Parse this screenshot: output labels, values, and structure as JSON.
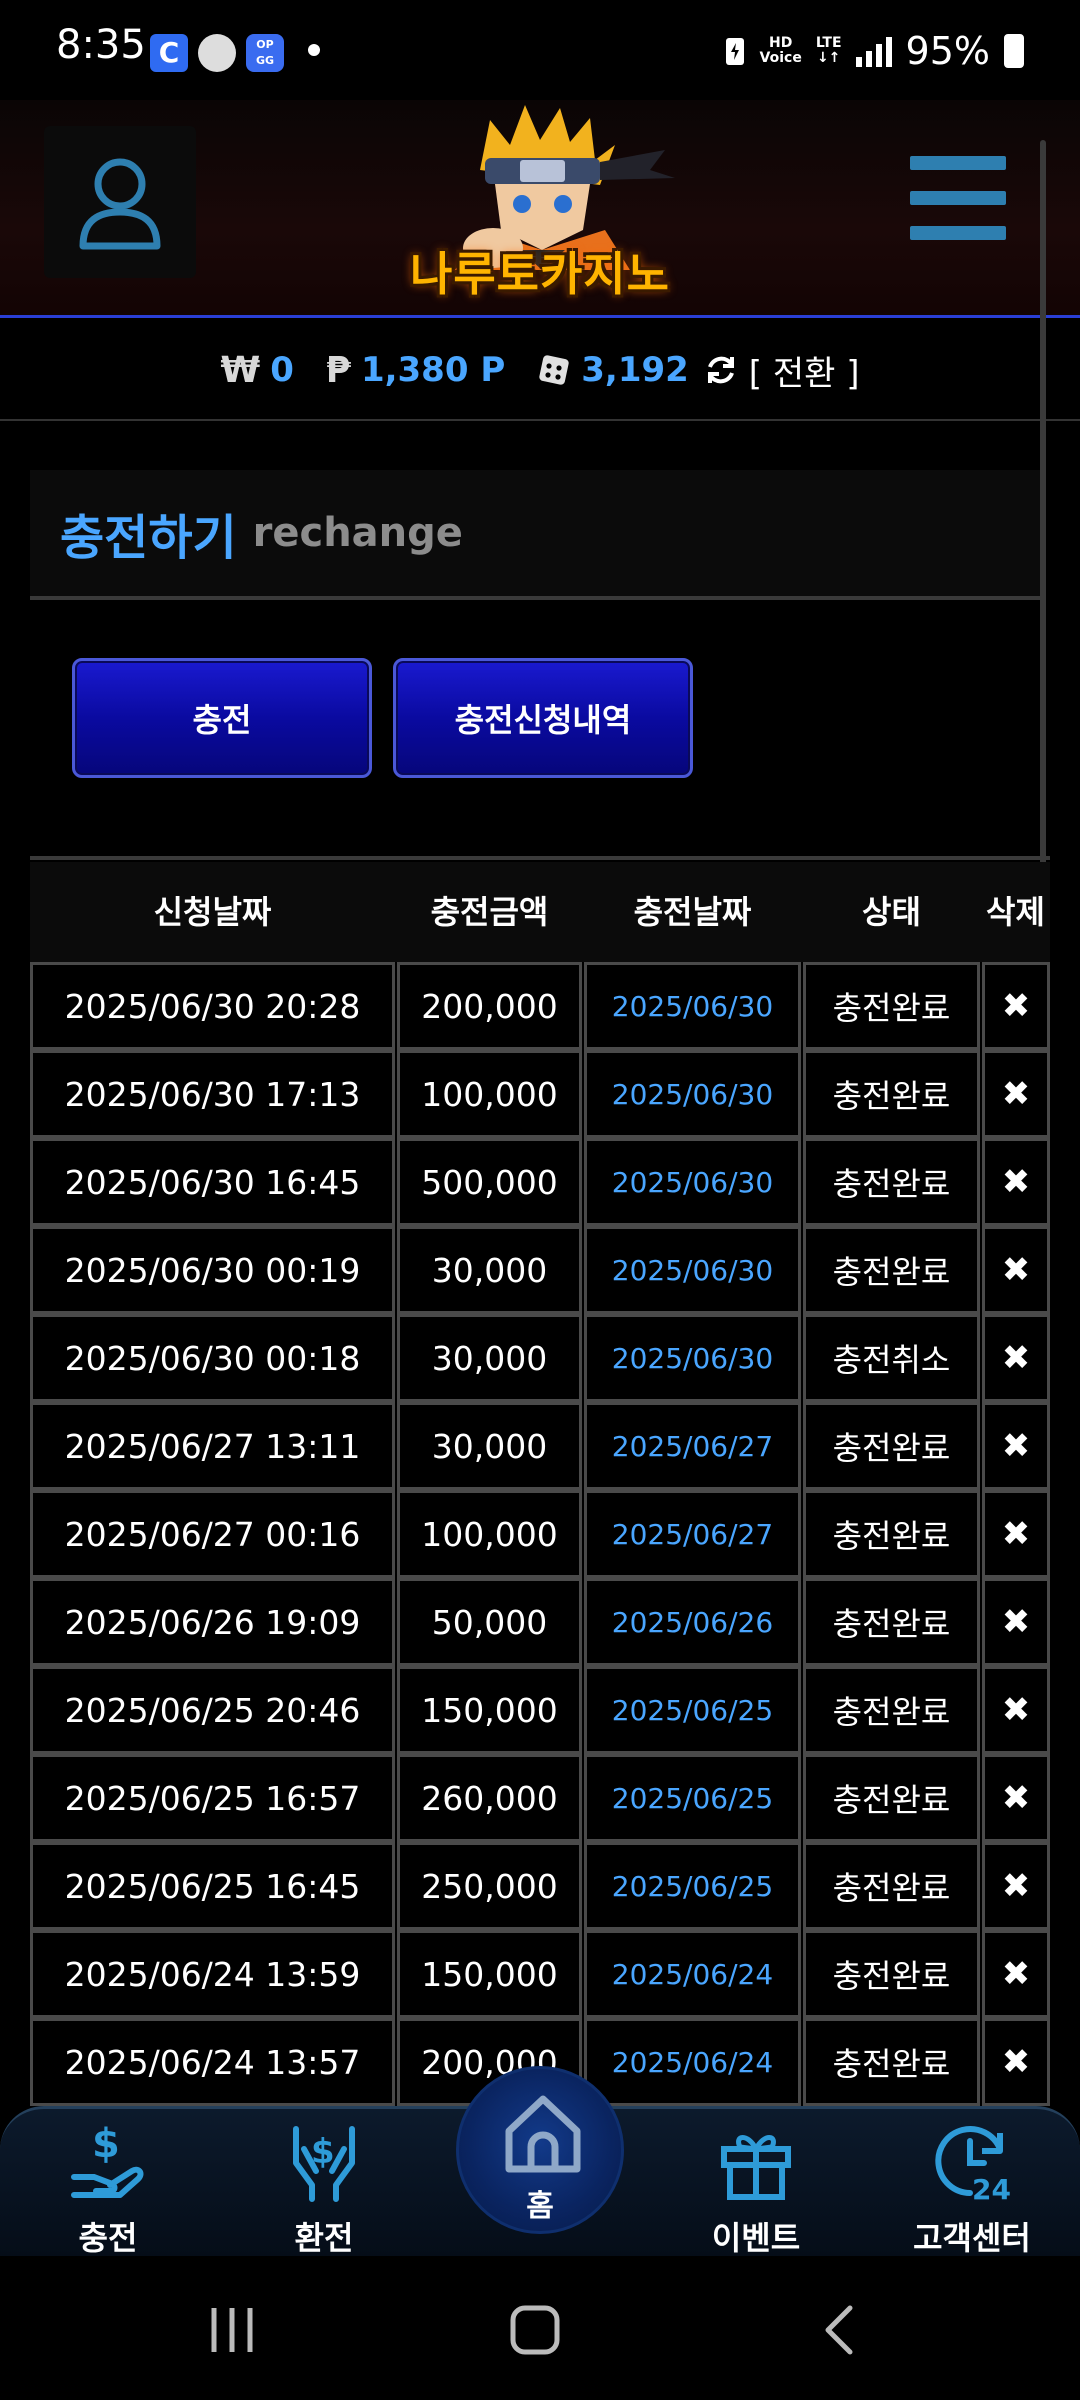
{
  "status_bar": {
    "time": "8:35",
    "notif_c": "C",
    "notif_op": "OP GG",
    "hd_voice_top": "HD",
    "hd_voice_bottom": "Voice",
    "network": "LTE",
    "battery": "95%"
  },
  "header": {
    "logo_text": "나루토카지노"
  },
  "balance": {
    "won_symbol": "₩",
    "won_value": "0",
    "point_symbol": "₱",
    "point_value": "1,380 P",
    "chip_value": "3,192",
    "swap_label": "[ 전환 ]"
  },
  "page": {
    "title_ko": "충전하기",
    "title_en": "rechange"
  },
  "buttons": {
    "recharge": "충전",
    "history": "충전신청내역"
  },
  "table": {
    "headers": [
      "신청날짜",
      "충전금액",
      "충전날짜",
      "상태",
      "삭제"
    ],
    "rows": [
      {
        "req_date": "2025/06/30 20:28",
        "amount": "200,000",
        "charge_date": "2025/06/30",
        "status": "충전완료",
        "del": "✖"
      },
      {
        "req_date": "2025/06/30 17:13",
        "amount": "100,000",
        "charge_date": "2025/06/30",
        "status": "충전완료",
        "del": "✖"
      },
      {
        "req_date": "2025/06/30 16:45",
        "amount": "500,000",
        "charge_date": "2025/06/30",
        "status": "충전완료",
        "del": "✖"
      },
      {
        "req_date": "2025/06/30 00:19",
        "amount": "30,000",
        "charge_date": "2025/06/30",
        "status": "충전완료",
        "del": "✖"
      },
      {
        "req_date": "2025/06/30 00:18",
        "amount": "30,000",
        "charge_date": "2025/06/30",
        "status": "충전취소",
        "del": "✖"
      },
      {
        "req_date": "2025/06/27 13:11",
        "amount": "30,000",
        "charge_date": "2025/06/27",
        "status": "충전완료",
        "del": "✖"
      },
      {
        "req_date": "2025/06/27 00:16",
        "amount": "100,000",
        "charge_date": "2025/06/27",
        "status": "충전완료",
        "del": "✖"
      },
      {
        "req_date": "2025/06/26 19:09",
        "amount": "50,000",
        "charge_date": "2025/06/26",
        "status": "충전완료",
        "del": "✖"
      },
      {
        "req_date": "2025/06/25 20:46",
        "amount": "150,000",
        "charge_date": "2025/06/25",
        "status": "충전완료",
        "del": "✖"
      },
      {
        "req_date": "2025/06/25 16:57",
        "amount": "260,000",
        "charge_date": "2025/06/25",
        "status": "충전완료",
        "del": "✖"
      },
      {
        "req_date": "2025/06/25 16:45",
        "amount": "250,000",
        "charge_date": "2025/06/25",
        "status": "충전완료",
        "del": "✖"
      },
      {
        "req_date": "2025/06/24 13:59",
        "amount": "150,000",
        "charge_date": "2025/06/24",
        "status": "충전완료",
        "del": "✖"
      },
      {
        "req_date": "2025/06/24 13:57",
        "amount": "200,000",
        "charge_date": "2025/06/24",
        "status": "충전완료",
        "del": "✖"
      }
    ]
  },
  "bottom_nav": {
    "recharge": "충전",
    "exchange": "환전",
    "home": "홈",
    "event": "이벤트",
    "support": "고객센터",
    "support_badge": "24"
  },
  "colors": {
    "accent_blue": "#4aa6ff",
    "button_blue": "#0a0aa0",
    "border_gray": "#4a4a4a"
  }
}
